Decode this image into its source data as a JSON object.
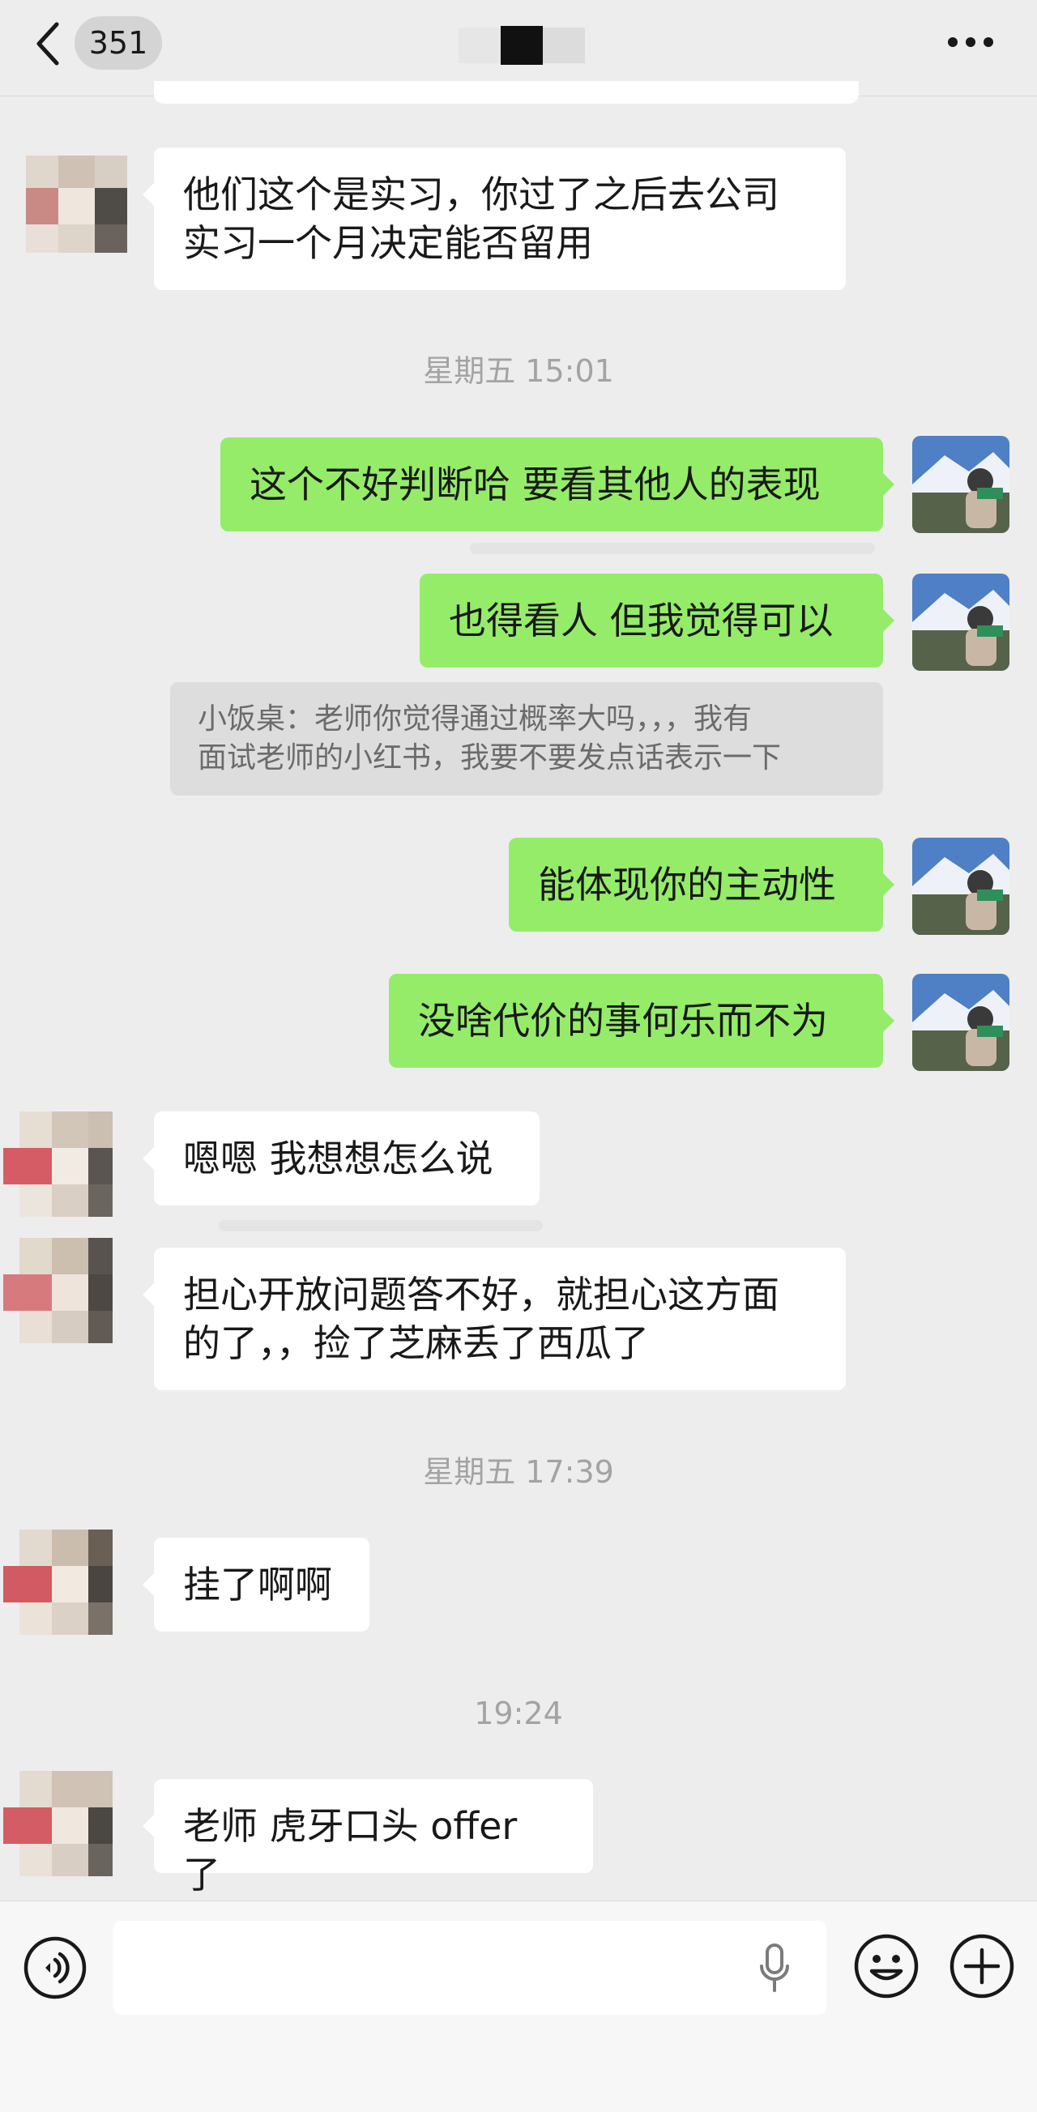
{
  "header": {
    "unread_count": "351"
  },
  "messages": [
    {
      "side": "left",
      "text": "他们这个是实习，你过了之后去公司\n实习一个月决定能否留用"
    },
    {
      "type": "timestamp",
      "text": "星期五 15:01"
    },
    {
      "side": "right",
      "text": "这个不好判断哈 要看其他人的表现"
    },
    {
      "side": "right",
      "text": "也得看人 但我觉得可以"
    },
    {
      "type": "quote",
      "text": "小饭桌：老师你觉得通过概率大吗，，，我有\n面试老师的小红书，我要不要发点话表示一下"
    },
    {
      "side": "right",
      "text": "能体现你的主动性"
    },
    {
      "side": "right",
      "text": "没啥代价的事何乐而不为"
    },
    {
      "side": "left",
      "text": "嗯嗯 我想想怎么说"
    },
    {
      "side": "left",
      "text": "担心开放问题答不好，就担心这方面\n的了，，捡了芝麻丢了西瓜了"
    },
    {
      "type": "timestamp",
      "text": "星期五 17:39"
    },
    {
      "side": "left",
      "text": "挂了啊啊"
    },
    {
      "type": "timestamp",
      "text": "19:24"
    },
    {
      "side": "left",
      "text": "老师 虎牙口头 offer 了"
    }
  ],
  "input_bar": {
    "placeholder": ""
  },
  "icons": {
    "back": "chevron-left-icon",
    "more": "more-dots-icon",
    "voice": "voice-icon",
    "mic": "mic-icon",
    "emoji": "emoji-icon",
    "plus": "plus-icon"
  },
  "colors": {
    "background": "#ededed",
    "bubble_self": "#95ec69",
    "bubble_other": "#ffffff",
    "timestamp": "#a3a3a3",
    "quote_bg": "#dddddd"
  }
}
